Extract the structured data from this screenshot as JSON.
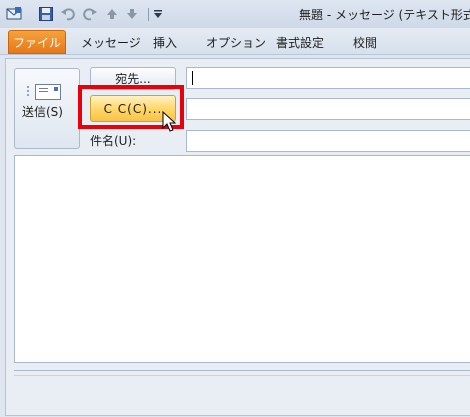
{
  "window": {
    "title": "無題 - メッセージ (テキスト形式)"
  },
  "quick_access": [
    {
      "name": "outlook-icon",
      "glyph": "✉"
    },
    {
      "name": "save-icon",
      "glyph": "■"
    },
    {
      "name": "undo-icon",
      "glyph": "↶"
    },
    {
      "name": "redo-icon",
      "glyph": "↷"
    },
    {
      "name": "up-arrow-icon",
      "glyph": "▲"
    },
    {
      "name": "down-arrow-icon",
      "glyph": "▼"
    },
    {
      "name": "customize-toolbar-icon",
      "glyph": "▾"
    }
  ],
  "ribbon": {
    "tabs": [
      "ファイル",
      "メッセージ",
      "挿入",
      "オプション",
      "書式設定",
      "校閲"
    ]
  },
  "compose": {
    "send_label": "送信(S)",
    "to_label": "宛先...",
    "cc_label": "C C(C)...",
    "subject_label": "件名(U):"
  },
  "colors": {
    "highlight": "#e8000b",
    "file_tab": "#e77817",
    "cc_button": "#ffd666"
  }
}
